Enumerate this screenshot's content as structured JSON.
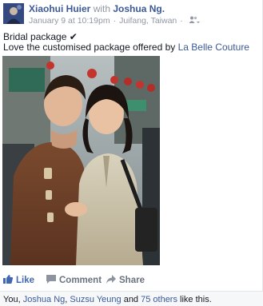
{
  "post": {
    "author": "Xiaohui Huier",
    "with_word": "with",
    "tagged": "Joshua Ng.",
    "date": "January 9 at 10:19pm",
    "separator": "·",
    "location": "Juifang, Taiwan",
    "line1": "Bridal package",
    "check": "✔",
    "line2_prefix": "Love the customised package offered by ",
    "line2_link": "La Belle Couture"
  },
  "actions": {
    "like": "Like",
    "comment": "Comment",
    "share": "Share"
  },
  "likes": {
    "you": "You, ",
    "name1": "Joshua Ng",
    "comma": ", ",
    "name2": "Suzsu Yeung",
    "and": " and ",
    "others": "75 others",
    "suffix": " like this."
  },
  "icons": {
    "privacy": "friends-icon",
    "dropdown": "caret-down-icon",
    "like": "thumbs-up-icon",
    "comment": "speech-bubble-icon",
    "share": "share-arrow-icon"
  },
  "colors": {
    "link": "#3b5998",
    "muted": "#9197a3",
    "like_active": "#4267b2",
    "action": "#6a7180"
  }
}
